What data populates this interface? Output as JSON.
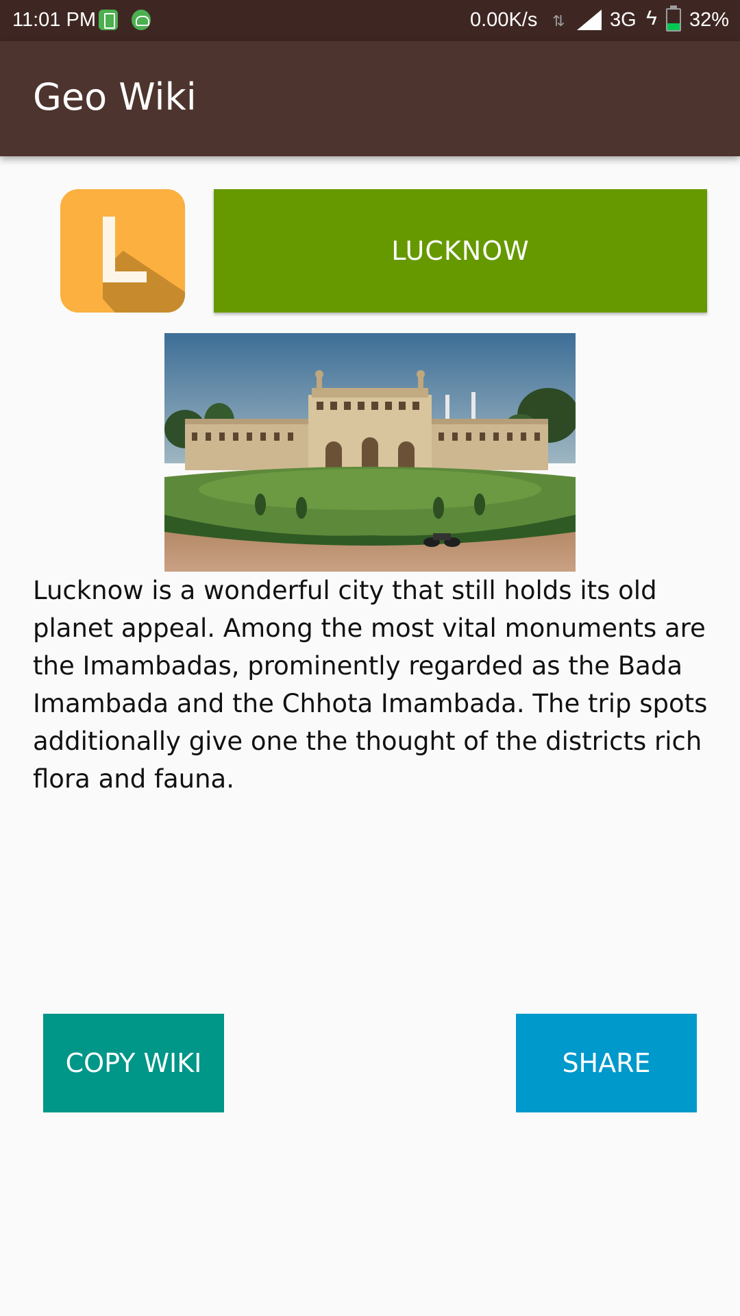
{
  "status_bar": {
    "time": "11:01 PM",
    "net_speed": "0.00K/s",
    "network_type": "3G",
    "battery_percent": "32%",
    "battery_level": 0.32
  },
  "app_bar": {
    "title": "Geo Wiki"
  },
  "city": {
    "logo_icon": "letter-l-app-icon",
    "name": "LUCKNOW",
    "photo_icon": "bara-imambara-photo",
    "description": "Lucknow is a wonderful city that still holds its old planet appeal. Among the most vital monuments are the Imambadas, prominently regarded as the Bada Imambada and the Chhota Imambada. The trip spots additionally give one the thought of the districts rich flora and fauna."
  },
  "actions": {
    "copy_label": "COPY WIKI",
    "share_label": "SHARE"
  },
  "colors": {
    "status_bar": "#3e2723",
    "app_bar": "#4e342e",
    "city_button": "#669900",
    "copy_button": "#009688",
    "share_button": "#0099cc",
    "logo": "#fbb040"
  }
}
